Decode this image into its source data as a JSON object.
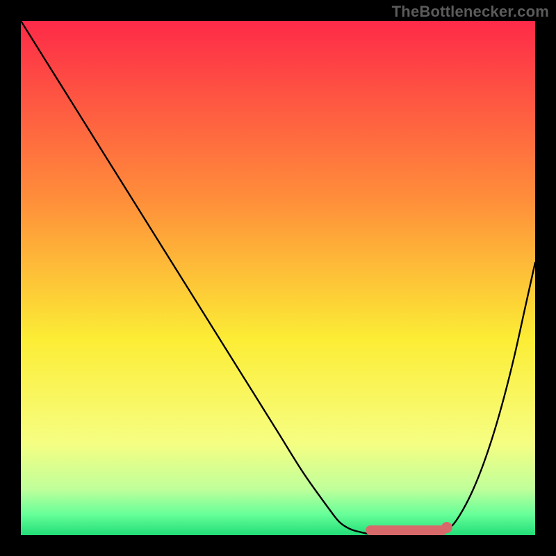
{
  "source_label": "TheBottlenecker.com",
  "colors": {
    "frame_bg": "#000000",
    "label": "#5b5b5b",
    "curve": "#000000",
    "marker_fill": "#d8696b",
    "marker_stroke": "#d8696b",
    "gradient_top": "#fe2a48",
    "gradient_mid1": "#ff8f3a",
    "gradient_mid2": "#fced35",
    "gradient_lower": "#f6fe82",
    "gradient_green1": "#c0ff9a",
    "gradient_green2": "#66ff99",
    "gradient_bottom": "#22dd77"
  },
  "chart_data": {
    "type": "line",
    "title": "",
    "xlabel": "",
    "ylabel": "",
    "xlim": [
      0,
      100
    ],
    "ylim": [
      0,
      100
    ],
    "grid": false,
    "legend": false,
    "x": [
      0,
      5,
      10,
      15,
      20,
      25,
      30,
      35,
      40,
      45,
      50,
      55,
      60,
      62,
      64,
      66,
      68,
      70,
      72,
      74,
      76,
      78,
      80,
      82,
      84,
      86,
      88,
      90,
      92,
      94,
      96,
      98,
      100
    ],
    "values": [
      100,
      92,
      84,
      76,
      68,
      60,
      52,
      44,
      36,
      28,
      20,
      12,
      5,
      2.5,
      1.2,
      0.6,
      0.2,
      0.05,
      0,
      0,
      0,
      0,
      0.05,
      0.6,
      2,
      5,
      9,
      14,
      20,
      27,
      35,
      44,
      53
    ],
    "minimum_band": {
      "x_start": 68,
      "x_end": 82,
      "y": 0
    },
    "annotations": []
  }
}
